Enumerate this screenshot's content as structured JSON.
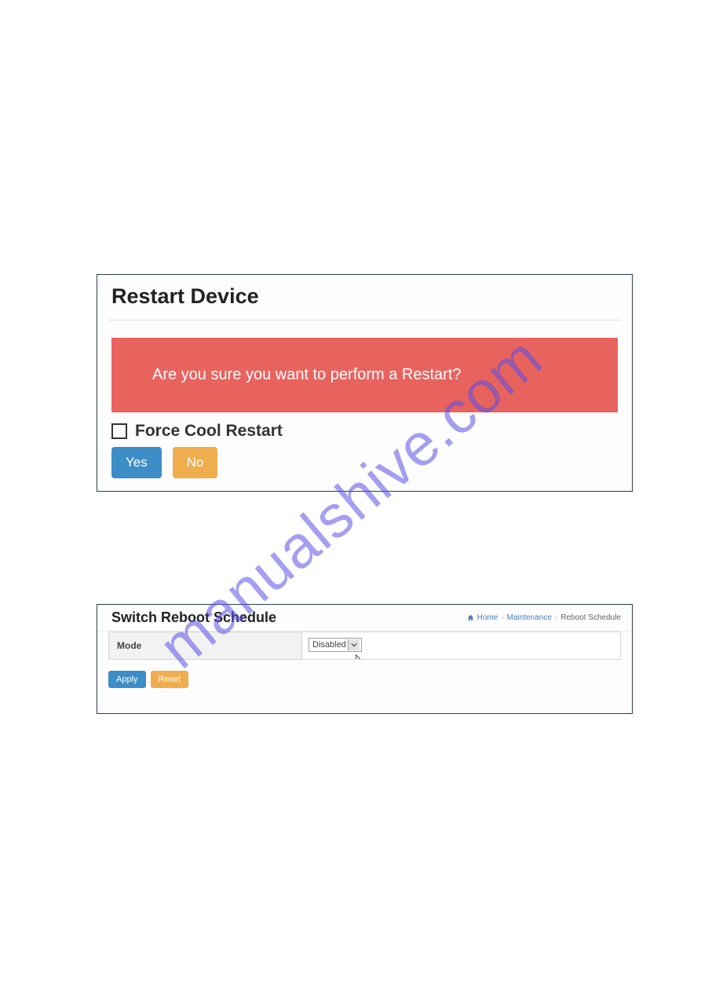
{
  "watermark": "manualshive.com",
  "restart_dialog": {
    "title": "Restart Device",
    "alert_message": "Are you sure you want to perform a Restart?",
    "checkbox_label": "Force Cool Restart",
    "yes_label": "Yes",
    "no_label": "No"
  },
  "reboot_schedule": {
    "title": "Switch Reboot Schedule",
    "breadcrumb": {
      "home": "Home",
      "level1": "Maintenance",
      "level2": "Reboot Schedule"
    },
    "mode_label": "Mode",
    "mode_value": "Disabled",
    "apply_label": "Apply",
    "reset_label": "Reset"
  }
}
